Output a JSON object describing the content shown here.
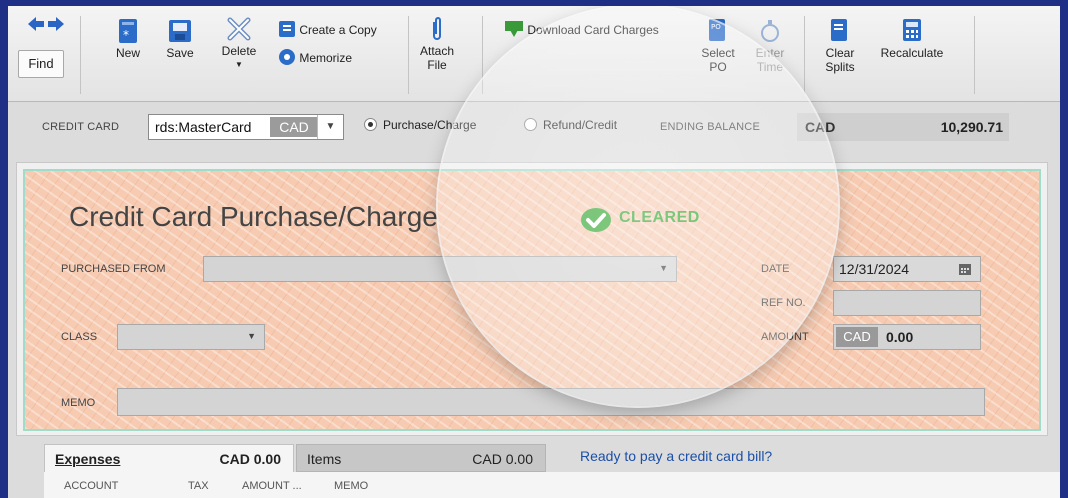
{
  "toolbar": {
    "find_label": "Find",
    "new_label": "New",
    "save_label": "Save",
    "delete_label": "Delete",
    "create_copy_label": "Create a Copy",
    "memorize_label": "Memorize",
    "attach_label_1": "Attach",
    "attach_label_2": "File",
    "download_label": "Download Card Charges",
    "select_po_1": "Select",
    "select_po_2": "PO",
    "enter_time_1": "Enter",
    "enter_time_2": "Time",
    "clear_splits_1": "Clear",
    "clear_splits_2": "Splits",
    "recalculate_label": "Recalculate"
  },
  "account_row": {
    "credit_card_label": "CREDIT CARD",
    "account_text": "rds:MasterCard",
    "account_currency": "CAD",
    "purchase_label": "Purchase/Charge",
    "refund_label": "Refund/Credit",
    "ending_balance_label": "ENDING BALANCE",
    "balance_currency": "CAD",
    "balance_amount": "10,290.71"
  },
  "form": {
    "title": "Credit Card Purchase/Charge",
    "status": "CLEARED",
    "purchased_from_label": "PURCHASED FROM",
    "date_label": "DATE",
    "date_value": "12/31/2024",
    "ref_no_label": "REF NO.",
    "class_label": "CLASS",
    "amount_label": "AMOUNT",
    "amount_currency": "CAD",
    "amount_value": "0.00",
    "memo_label": "MEMO"
  },
  "tabs": {
    "expenses_label": "Expenses",
    "expenses_amount": "CAD 0.00",
    "items_label": "Items",
    "items_amount": "CAD 0.00",
    "ready_link": "Ready to pay a credit card bill?"
  },
  "grid": {
    "columns": [
      "ACCOUNT",
      "TAX",
      "AMOUNT ...",
      "MEMO"
    ]
  },
  "colors": {
    "frame": "#1f2f86",
    "cleared_green": "#2ea52e",
    "link_blue": "#1b4fa8",
    "form_peach": "#f6cbb2"
  }
}
